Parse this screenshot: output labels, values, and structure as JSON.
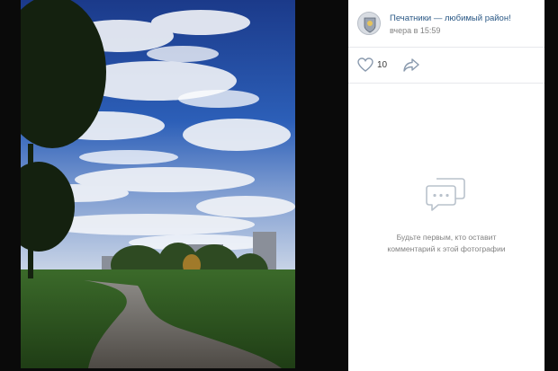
{
  "post": {
    "group_name": "Печатники — любимый район!",
    "time": "вчера в 15:59"
  },
  "actions": {
    "like_count": "10",
    "like_icon": "heart-icon",
    "share_icon": "share-icon"
  },
  "comments": {
    "empty_line1": "Будьте первым, кто оставит",
    "empty_line2": "комментарий к этой фотографии",
    "empty_icon": "comments-icon"
  },
  "colors": {
    "link": "#2a5885",
    "muted": "#828282",
    "icon": "#aeb7c2"
  }
}
